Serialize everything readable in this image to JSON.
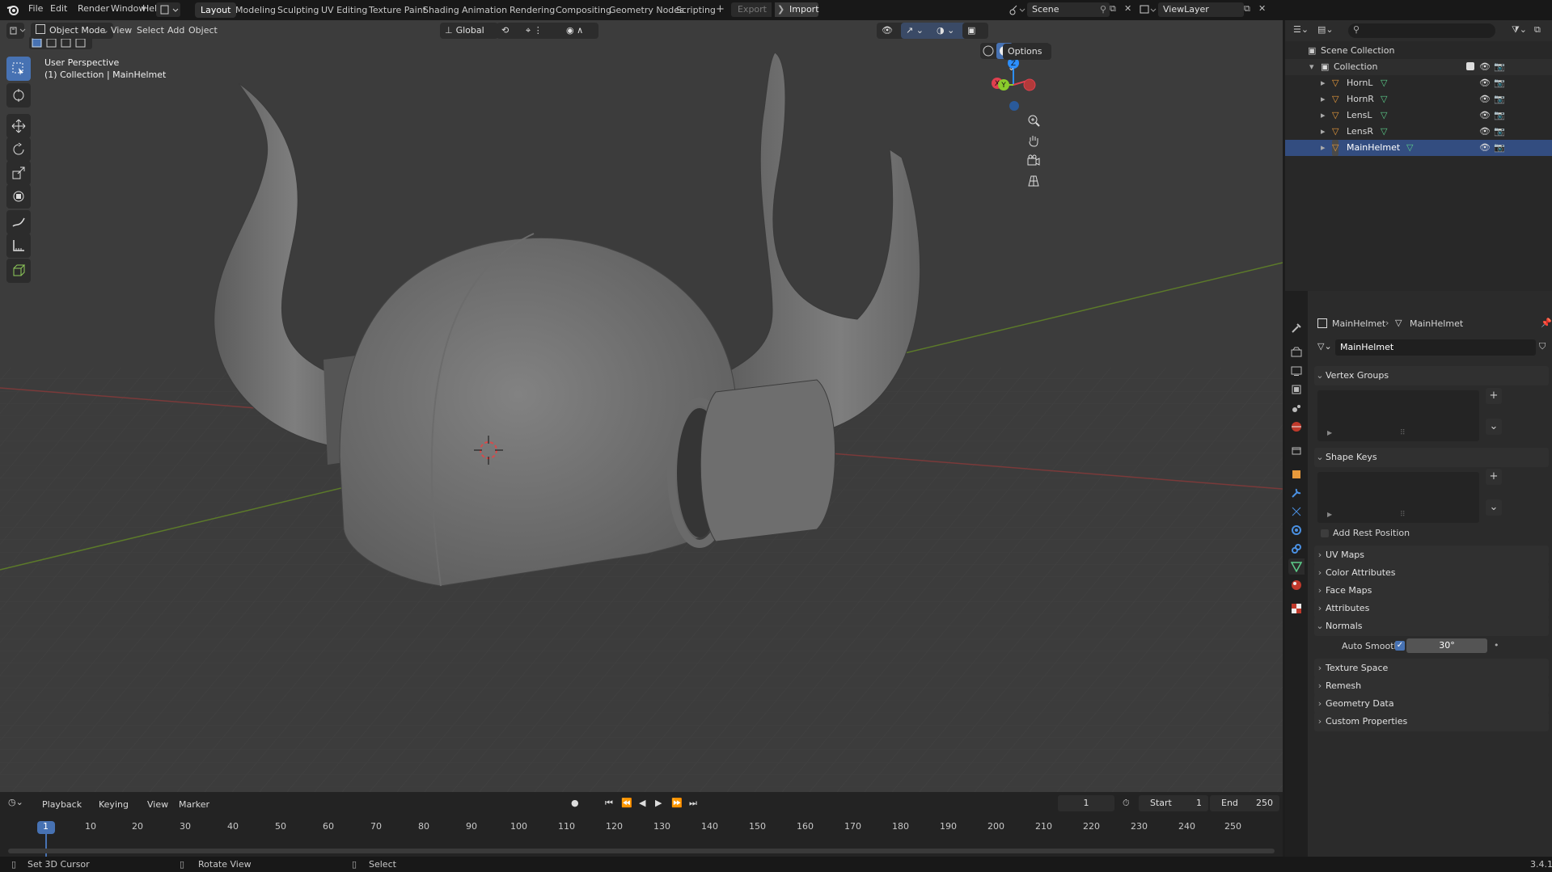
{
  "topbar": {
    "menus": [
      "File",
      "Edit",
      "Render",
      "Window",
      "Help"
    ],
    "workspaces": [
      "Layout",
      "Modeling",
      "Sculpting",
      "UV Editing",
      "Texture Paint",
      "Shading",
      "Animation",
      "Rendering",
      "Compositing",
      "Geometry Nodes",
      "Scripting"
    ],
    "active_workspace": "Layout",
    "export_label": "Export",
    "import_label": "Import",
    "scene_name": "Scene",
    "view_layer": "ViewLayer"
  },
  "viewport": {
    "mode": "Object Mode",
    "menus": [
      "View",
      "Select",
      "Add",
      "Object"
    ],
    "orientation": "Global",
    "options_label": "Options",
    "perspective_label": "User Perspective",
    "collection_label": "(1) Collection | MainHelmet",
    "gizmo_axes": [
      "X",
      "Y",
      "Z"
    ],
    "colors": {
      "x_axis": "#e0404f",
      "y_axis": "#8acb2c",
      "z_axis": "#2c8fff",
      "accent": "#4772b3",
      "object": "#777777"
    }
  },
  "outliner": {
    "root": "Scene Collection",
    "collection": "Collection",
    "objects": [
      "HornL",
      "HornR",
      "LensL",
      "LensR",
      "MainHelmet"
    ]
  },
  "properties": {
    "breadcrumb_object": "MainHelmet",
    "breadcrumb_data": "MainHelmet",
    "mesh_name": "MainHelmet",
    "panels": {
      "vertex_groups": "Vertex Groups",
      "shape_keys": "Shape Keys",
      "add_rest_position": "Add Rest Position",
      "uv_maps": "UV Maps",
      "color_attributes": "Color Attributes",
      "face_maps": "Face Maps",
      "attributes": "Attributes",
      "normals": "Normals",
      "auto_smooth_label": "Auto Smooth",
      "auto_smooth_angle": "30°",
      "texture_space": "Texture Space",
      "remesh": "Remesh",
      "geometry_data": "Geometry Data",
      "custom_properties": "Custom Properties"
    }
  },
  "timeline": {
    "menus": [
      "Playback",
      "Keying",
      "View",
      "Marker"
    ],
    "current_frame": "1",
    "start_label": "Start",
    "start_value": "1",
    "end_label": "End",
    "end_value": "250",
    "frame_marks": [
      "1",
      "10",
      "20",
      "30",
      "40",
      "50",
      "60",
      "70",
      "80",
      "90",
      "100",
      "110",
      "120",
      "130",
      "140",
      "150",
      "160",
      "170",
      "180",
      "190",
      "200",
      "210",
      "220",
      "230",
      "240",
      "250"
    ]
  },
  "statusbar": {
    "hint1": "Set 3D Cursor",
    "hint2": "Rotate View",
    "hint3": "Select",
    "version": "3.4.1"
  }
}
